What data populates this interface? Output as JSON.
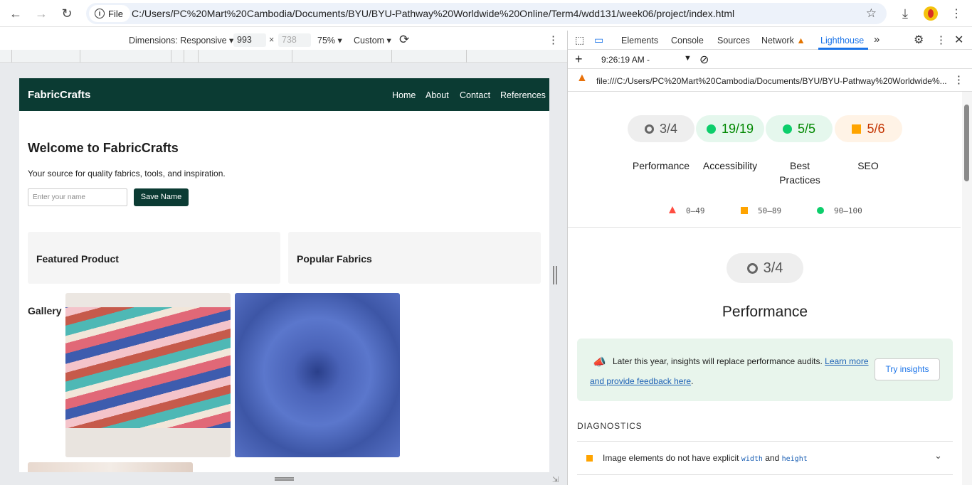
{
  "browser": {
    "file_chip": "File",
    "url": "C:/Users/PC%20Mart%20Cambodia/Documents/BYU/BYU-Pathway%20Worldwide%20Online/Term4/wdd131/week06/project/index.html"
  },
  "device_toolbar": {
    "dimensions_label": "Dimensions: Responsive",
    "width": "993",
    "height_placeholder": "738",
    "times": "×",
    "zoom": "75%",
    "throttle": "Custom"
  },
  "site": {
    "brand": "FabricCrafts",
    "nav": [
      "Home",
      "About",
      "Contact",
      "References"
    ],
    "heading": "Welcome to FabricCrafts",
    "tagline": "Your source for quality fabrics, tools, and inspiration.",
    "name_placeholder": "Enter your name",
    "save_button": "Save Name",
    "card1": "Featured Product",
    "card2": "Popular Fabrics",
    "gallery_label": "Gallery"
  },
  "devtools": {
    "tabs": [
      "Elements",
      "Console",
      "Sources",
      "Network",
      "Lighthouse"
    ],
    "report_time": "9:26:19 AM -",
    "report_url": "file:///C:/Users/PC%20Mart%20Cambodia/Documents/BYU/BYU-Pathway%20Worldwide%...",
    "scores": [
      {
        "value": "3/4",
        "label": "Performance",
        "kind": "neutral"
      },
      {
        "value": "19/19",
        "label": "Accessibility",
        "kind": "pass"
      },
      {
        "value": "5/5",
        "label": "Best Practices",
        "kind": "pass"
      },
      {
        "value": "5/6",
        "label": "SEO",
        "kind": "average"
      }
    ],
    "legend": [
      "0–49",
      "50–89",
      "90–100"
    ],
    "perf_score": "3/4",
    "perf_title": "Performance",
    "banner_text": "Later this year, insights will replace performance audits.",
    "banner_link1": "Learn more",
    "banner_link2": "and provide feedback here",
    "banner_period": ".",
    "try_insights": "Try insights",
    "diagnostics": "DIAGNOSTICS",
    "diag_item_prefix": "Image elements do not have explicit",
    "diag_code1": "width",
    "diag_and": "and",
    "diag_code2": "height"
  },
  "colors": {
    "site_header": "#0b3b33",
    "pass": "#0cce6b",
    "average": "#ffa400",
    "fail": "#ff4e42",
    "devtools_accent": "#1a73e8"
  }
}
